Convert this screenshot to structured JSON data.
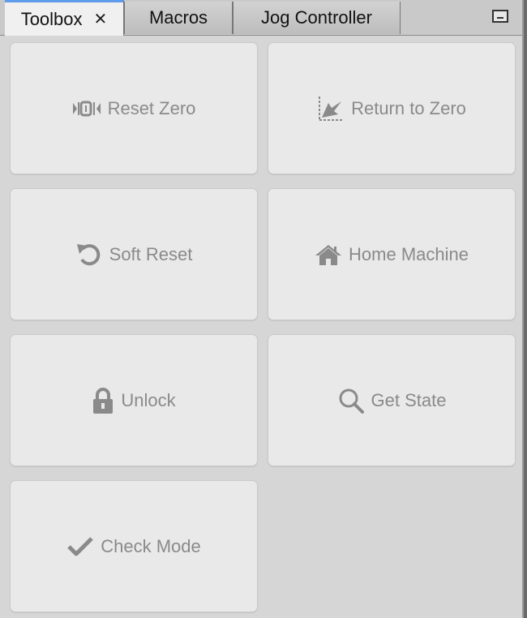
{
  "tabs": [
    {
      "label": "Toolbox",
      "close": "✕",
      "active": true
    },
    {
      "label": "Macros"
    },
    {
      "label": "Jog Controller"
    }
  ],
  "buttons": [
    {
      "label": "Reset Zero",
      "icon": "reset-zero-icon"
    },
    {
      "label": "Return to Zero",
      "icon": "return-to-zero-icon"
    },
    {
      "label": "Soft Reset",
      "icon": "undo-icon"
    },
    {
      "label": "Home Machine",
      "icon": "home-icon"
    },
    {
      "label": "Unlock",
      "icon": "lock-icon"
    },
    {
      "label": "Get State",
      "icon": "search-icon"
    },
    {
      "label": "Check Mode",
      "icon": "checkmark-icon"
    }
  ],
  "colors": {
    "active_tab_accent": "#5e9bea",
    "button_bg": "#e9e9e9",
    "button_text": "#8a8a8a",
    "panel_bg": "#d6d6d6"
  }
}
